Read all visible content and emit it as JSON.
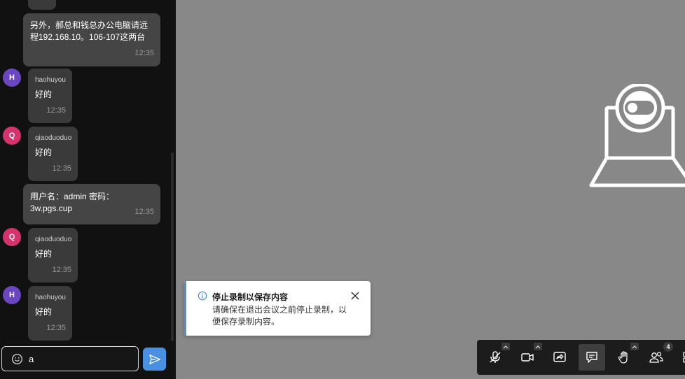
{
  "chat": {
    "messages": [
      {
        "text": "另外，郝总和钱总办公电脑请远程192.168.10。106-107这两台",
        "time": "12:35"
      },
      {
        "avatar": "H",
        "sender": "haohuyou",
        "text": "好的",
        "time": "12:35"
      },
      {
        "avatar": "Q",
        "sender": "qiaoduoduo",
        "text": "好的",
        "time": "12:35"
      },
      {
        "text": "用户名：admin 密码：3w.pgs.cup",
        "time": "12:35"
      },
      {
        "avatar": "Q",
        "sender": "qiaoduoduo",
        "text": "好的",
        "time": "12:35"
      },
      {
        "avatar": "H",
        "sender": "haohuyou",
        "text": "好的",
        "time": "12:35"
      }
    ],
    "composer": {
      "value": "a"
    }
  },
  "toast": {
    "title": "停止录制以保存内容",
    "message": "请确保在退出会议之前停止录制，以便保存录制内容。"
  },
  "toolbar": {
    "participants_count": "4",
    "buttons": [
      "mic-muted-icon",
      "camera-icon",
      "share-screen-icon",
      "chat-icon",
      "raise-hand-icon",
      "participants-icon",
      "more-icon"
    ]
  },
  "colors": {
    "accent": "#4a90e2",
    "avatar_h": "#6b46c1",
    "avatar_q": "#d6336c",
    "stage_bg": "#888888",
    "chat_bg": "#111111"
  }
}
